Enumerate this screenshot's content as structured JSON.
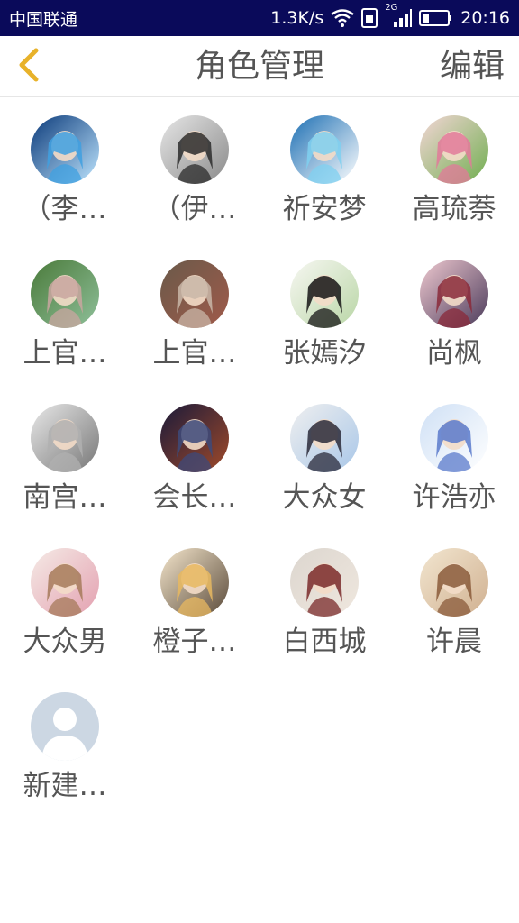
{
  "status_bar": {
    "carrier": "中国联通",
    "speed": "1.3K/s",
    "network_type": "2G",
    "time": "20:16",
    "icons": [
      "wifi-icon",
      "sim-icon",
      "signal-icon",
      "battery-icon"
    ]
  },
  "nav": {
    "back_icon": "chevron-left-icon",
    "title": "角色管理",
    "edit_label": "编辑",
    "back_color": "#e8b22a"
  },
  "roles": [
    {
      "name": "（李…",
      "palette": [
        "#0b3a7a",
        "#3fa0e0",
        "#bfe6ff"
      ]
    },
    {
      "name": "（伊…",
      "palette": [
        "#e6e6e6",
        "#2b2b2b",
        "#8a8a8a"
      ]
    },
    {
      "name": "祈安梦",
      "palette": [
        "#1d6fb3",
        "#7fd0f0",
        "#ffffff"
      ]
    },
    {
      "name": "高琉萘",
      "palette": [
        "#f4d6d6",
        "#e27a9a",
        "#6fae4f"
      ]
    },
    {
      "name": "上官…",
      "palette": [
        "#4a7a3a",
        "#c9a6a0",
        "#8fc09a"
      ]
    },
    {
      "name": "上官…",
      "palette": [
        "#6a5a4a",
        "#c9b7a8",
        "#a05a4a"
      ]
    },
    {
      "name": "张嫣汐",
      "palette": [
        "#f7f7f2",
        "#151515",
        "#b9d6a6"
      ]
    },
    {
      "name": "尚枫",
      "palette": [
        "#efc9d0",
        "#8a2a3a",
        "#4a3a5a"
      ]
    },
    {
      "name": "南宫…",
      "palette": [
        "#e8e8e8",
        "#b0b0b0",
        "#777777"
      ]
    },
    {
      "name": "会长…",
      "palette": [
        "#1a1a3a",
        "#3d4a7a",
        "#a04a2a"
      ]
    },
    {
      "name": "大众女",
      "palette": [
        "#efefef",
        "#2a2a3a",
        "#a9c7e8"
      ]
    },
    {
      "name": "许浩亦",
      "palette": [
        "#cfe0f5",
        "#5a7acb",
        "#ffffff"
      ]
    },
    {
      "name": "大众男",
      "palette": [
        "#f5ebe6",
        "#a67a5a",
        "#e3a0b0"
      ]
    },
    {
      "name": "橙子…",
      "palette": [
        "#f4e6cc",
        "#e8b860",
        "#5a4a3a"
      ]
    },
    {
      "name": "白西城",
      "palette": [
        "#dcd6cf",
        "#7a2a2a",
        "#efe7de"
      ]
    },
    {
      "name": "许晨",
      "palette": [
        "#f2e6d0",
        "#8a5a3a",
        "#d0b090"
      ]
    },
    {
      "name": "新建…",
      "palette": [
        "#ccd7e3",
        "#ffffff",
        "#ccd7e3"
      ],
      "placeholder": true
    }
  ]
}
